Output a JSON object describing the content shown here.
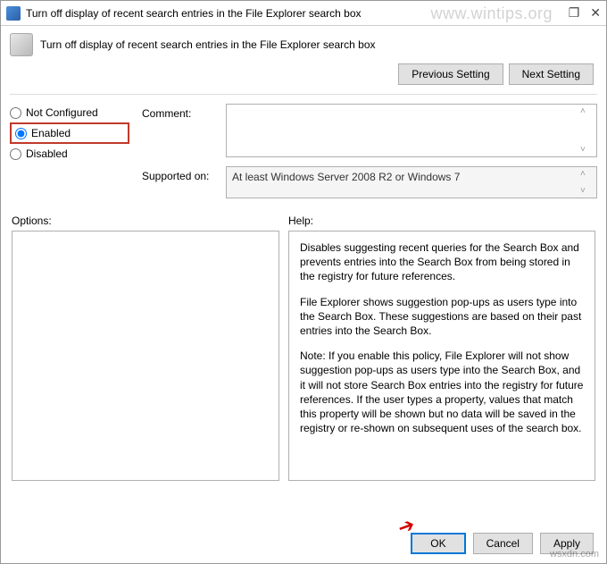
{
  "window": {
    "title": "Turn off display of recent search entries in the File Explorer search box"
  },
  "header": {
    "title": "Turn off display of recent search entries in the File Explorer search box",
    "prev_button": "Previous Setting",
    "next_button": "Next Setting"
  },
  "radio": {
    "not_configured": "Not Configured",
    "enabled": "Enabled",
    "disabled": "Disabled",
    "selected": "enabled"
  },
  "fields": {
    "comment_label": "Comment:",
    "comment_value": "",
    "supported_label": "Supported on:",
    "supported_value": "At least Windows Server 2008 R2 or Windows 7"
  },
  "lower": {
    "options_label": "Options:",
    "help_label": "Help:",
    "help_text": {
      "p1": "Disables suggesting recent queries for the Search Box and prevents entries into the Search Box from being stored in the registry for future references.",
      "p2": "File Explorer shows suggestion pop-ups as users type into the Search Box.  These suggestions are based on their past entries into the Search Box.",
      "p3": "Note: If you enable this policy, File Explorer will not show suggestion pop-ups as users type into the Search Box, and it will not store Search Box entries into the registry for future references.  If the user types a property, values that match this property will be shown but no data will be saved in the registry or re-shown on subsequent uses of the search box."
    }
  },
  "footer": {
    "ok": "OK",
    "cancel": "Cancel",
    "apply": "Apply"
  },
  "watermark": {
    "top": "www.wintips.org",
    "bottom": "wsxdn.com"
  }
}
